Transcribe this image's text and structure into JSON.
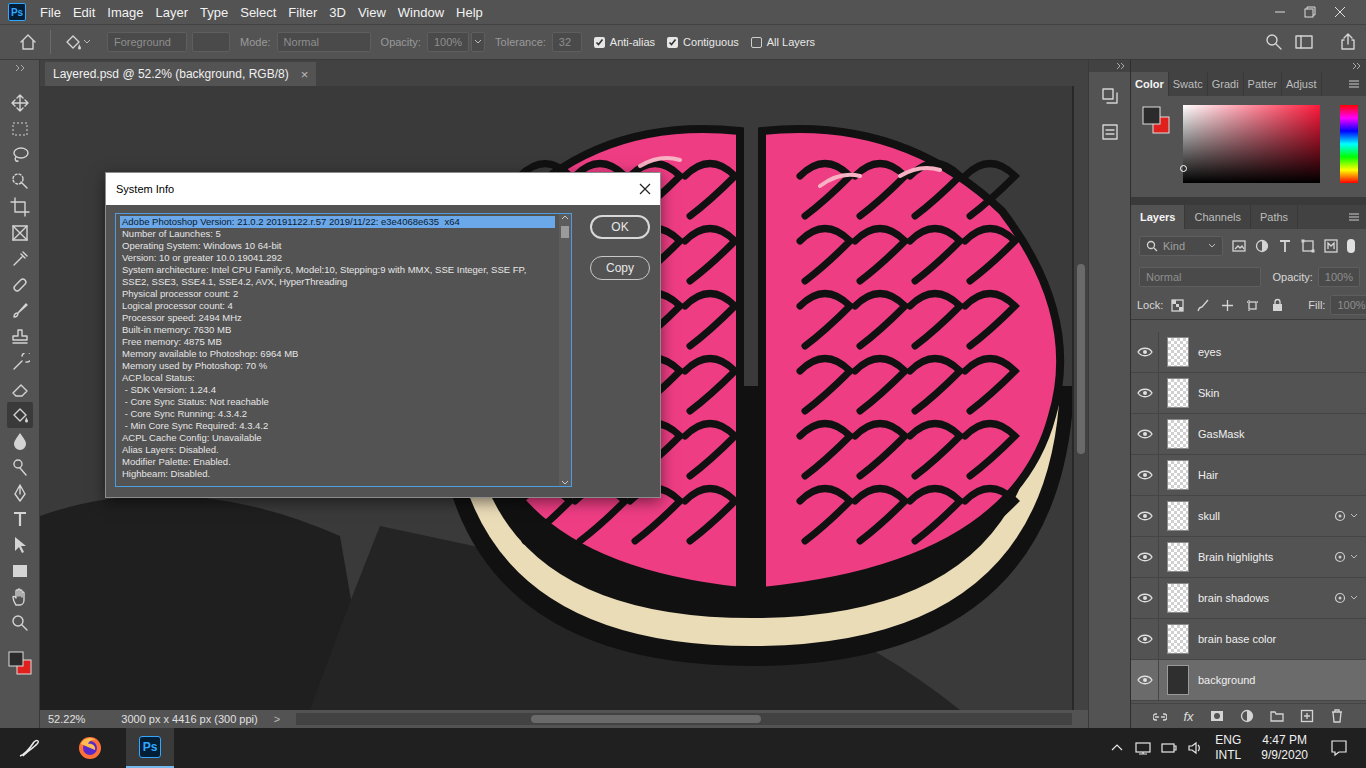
{
  "app": {
    "logo": "Ps"
  },
  "menu": [
    "File",
    "Edit",
    "Image",
    "Layer",
    "Type",
    "Select",
    "Filter",
    "3D",
    "View",
    "Window",
    "Help"
  ],
  "options_bar": {
    "source": "Foreground",
    "mode_label": "Mode:",
    "mode": "Normal",
    "opacity_label": "Opacity:",
    "opacity": "100%",
    "tolerance_label": "Tolerance:",
    "tolerance": "32",
    "checkboxes": [
      {
        "label": "Anti-alias",
        "checked": true
      },
      {
        "label": "Contiguous",
        "checked": true
      },
      {
        "label": "All Layers",
        "checked": false
      }
    ]
  },
  "tools": [
    {
      "kind": "move",
      "selected": false
    },
    {
      "kind": "marquee",
      "selected": false
    },
    {
      "kind": "lasso",
      "selected": false
    },
    {
      "kind": "quick-select",
      "selected": false
    },
    {
      "kind": "crop",
      "selected": false
    },
    {
      "kind": "frame",
      "selected": false
    },
    {
      "kind": "eyedropper",
      "selected": false
    },
    {
      "kind": "healing",
      "selected": false
    },
    {
      "kind": "brush",
      "selected": false
    },
    {
      "kind": "stamp",
      "selected": false
    },
    {
      "kind": "history",
      "selected": false
    },
    {
      "kind": "eraser",
      "selected": false
    },
    {
      "kind": "bucket",
      "selected": true
    },
    {
      "kind": "blur",
      "selected": false
    },
    {
      "kind": "dodge",
      "selected": false
    },
    {
      "kind": "pen",
      "selected": false
    },
    {
      "kind": "type",
      "selected": false
    },
    {
      "kind": "path-select",
      "selected": false
    },
    {
      "kind": "rectangle",
      "selected": false
    },
    {
      "kind": "hand",
      "selected": false
    },
    {
      "kind": "zoom",
      "selected": false
    }
  ],
  "document": {
    "tab": "Layered.psd @ 52.2% (background, RGB/8)",
    "close": "×"
  },
  "status_bar": {
    "zoom": "52.22%",
    "size": "3000 px x 4416 px (300 ppi)",
    "arrow": ">"
  },
  "color_panel": {
    "tabs": [
      {
        "label": "Color",
        "selected": true
      },
      {
        "label": "Swatc",
        "selected": false
      },
      {
        "label": "Gradi",
        "selected": false
      },
      {
        "label": "Patter",
        "selected": false
      },
      {
        "label": "Adjust",
        "selected": false
      }
    ]
  },
  "layers_panel": {
    "tabs": [
      {
        "label": "Layers",
        "selected": true
      },
      {
        "label": "Channels",
        "selected": false
      },
      {
        "label": "Paths",
        "selected": false
      }
    ],
    "filter": "Kind",
    "blend": "Normal",
    "opacity_label": "Opacity:",
    "opacity": "100%",
    "lock_label": "Lock:",
    "fill_label": "Fill:",
    "fill": "100%",
    "fx": "fx",
    "layers": [
      {
        "name": "eyes",
        "visible": true,
        "selected": false,
        "effects": false,
        "kind": "layer"
      },
      {
        "name": "Skin",
        "visible": true,
        "selected": false,
        "effects": false,
        "kind": "layer"
      },
      {
        "name": "GasMask",
        "visible": true,
        "selected": false,
        "effects": false,
        "kind": "layer"
      },
      {
        "name": "Hair",
        "visible": true,
        "selected": false,
        "effects": false,
        "kind": "layer"
      },
      {
        "name": "skull",
        "visible": true,
        "selected": false,
        "effects": true,
        "kind": "layer"
      },
      {
        "name": "Brain highlights",
        "visible": true,
        "selected": false,
        "effects": true,
        "kind": "layer"
      },
      {
        "name": "brain shadows",
        "visible": true,
        "selected": false,
        "effects": true,
        "kind": "layer"
      },
      {
        "name": "brain base color",
        "visible": true,
        "selected": false,
        "effects": false,
        "kind": "layer"
      },
      {
        "name": "background",
        "visible": true,
        "selected": true,
        "effects": false,
        "kind": "background"
      }
    ]
  },
  "dialog": {
    "title": "System Info",
    "lines": [
      {
        "text": "Adobe Photoshop Version: 21.0.2 20191122.r.57 2019/11/22: e3e4068e635  x64",
        "selected": true
      },
      {
        "text": "Number of Launches: 5",
        "selected": false
      },
      {
        "text": "Operating System: Windows 10 64-bit",
        "selected": false
      },
      {
        "text": "Version: 10 or greater 10.0.19041.292",
        "selected": false
      },
      {
        "text": "System architecture: Intel CPU Family:6, Model:10, Stepping:9 with MMX, SSE Integer, SSE FP,",
        "selected": false
      },
      {
        "text": "SSE2, SSE3, SSE4.1, SSE4.2, AVX, HyperThreading",
        "selected": false
      },
      {
        "text": "Physical processor count: 2",
        "selected": false
      },
      {
        "text": "Logical processor count: 4",
        "selected": false
      },
      {
        "text": "Processor speed: 2494 MHz",
        "selected": false
      },
      {
        "text": "Built-in memory: 7630 MB",
        "selected": false
      },
      {
        "text": "Free memory: 4875 MB",
        "selected": false
      },
      {
        "text": "Memory available to Photoshop: 6964 MB",
        "selected": false
      },
      {
        "text": "Memory used by Photoshop: 70 %",
        "selected": false
      },
      {
        "text": "ACP.local Status:",
        "selected": false
      },
      {
        "text": " - SDK Version: 1.24.4",
        "selected": false
      },
      {
        "text": " - Core Sync Status: Not reachable",
        "selected": false
      },
      {
        "text": " - Core Sync Running: 4.3.4.2",
        "selected": false
      },
      {
        "text": " - Min Core Sync Required: 4.3.4.2",
        "selected": false
      },
      {
        "text": "ACPL Cache Config: Unavailable",
        "selected": false
      },
      {
        "text": "Alias Layers: Disabled.",
        "selected": false
      },
      {
        "text": "Modifier Palette: Enabled.",
        "selected": false
      },
      {
        "text": "Highbeam: Disabled.",
        "selected": false
      }
    ],
    "buttons": [
      {
        "label": "OK",
        "default": true
      },
      {
        "label": "Copy",
        "default": false
      }
    ]
  },
  "taskbar": {
    "apps": [
      {
        "kind": "ink",
        "selected": false
      },
      {
        "kind": "firefox",
        "selected": false
      },
      {
        "kind": "photoshop",
        "label": "Ps",
        "selected": true
      }
    ],
    "language": "ENG",
    "layout": "INTL",
    "time": "4:47 PM",
    "date": "9/9/2020"
  }
}
